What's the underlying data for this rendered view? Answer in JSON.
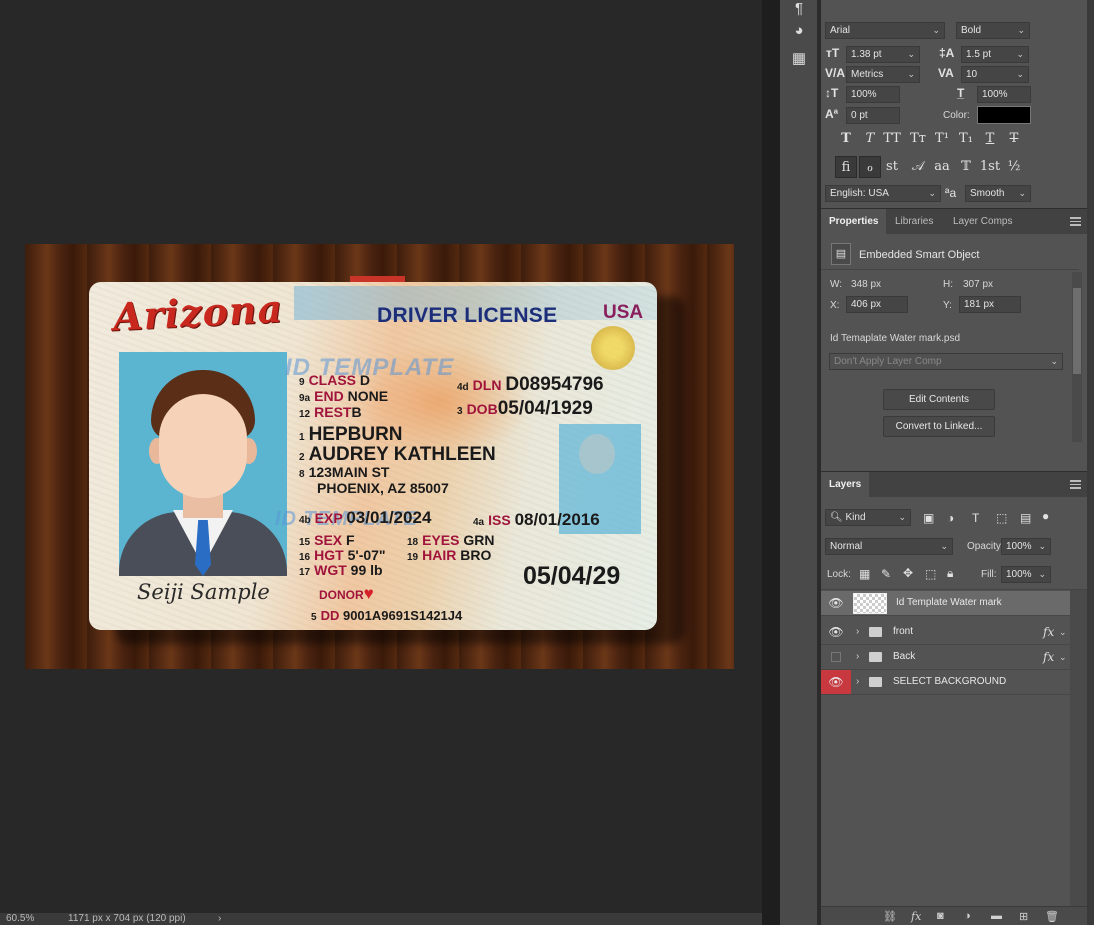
{
  "status_bar": {
    "zoom": "60.5%",
    "doc_info": "1171 px x 704 px (120 ppi)",
    "arrow": "›"
  },
  "document": {
    "card": {
      "state_name": "Arizona",
      "title": "DRIVER LICENSE",
      "country": "USA",
      "watermark_1": "ID TEMPLATE",
      "watermark_2": "ID TEMPLATE",
      "signature": "Seiji Sample",
      "class_num": "9",
      "class_label": "CLASS",
      "class_value": "D",
      "end_num": "9a",
      "end_label": "END",
      "end_value": "NONE",
      "rest_num": "12",
      "rest_label": "REST",
      "rest_value": "B",
      "dln_num": "4d",
      "dln_label": "DLN",
      "dln_value": "D08954796",
      "dob_num": "3",
      "dob_label": "DOB",
      "dob_value": "05/04/1929",
      "surname_num": "1",
      "surname": "HEPBURN",
      "given_num": "2",
      "given": "AUDREY KATHLEEN",
      "addr_num": "8",
      "address_1": "123MAIN ST",
      "address_2": "PHOENIX, AZ 85007",
      "exp_num": "4b",
      "exp_label": "EXP",
      "exp_value": "03/01/2024",
      "iss_num": "4a",
      "iss_label": "ISS",
      "iss_value": "08/01/2016",
      "sex_num": "15",
      "sex_label": "SEX",
      "sex_value": "F",
      "eyes_num": "18",
      "eyes_label": "EYES",
      "eyes_value": "GRN",
      "hgt_num": "16",
      "hgt_label": "HGT",
      "hgt_value": "5'-07\"",
      "hair_num": "19",
      "hair_label": "HAIR",
      "hair_value": "BRO",
      "wgt_num": "17",
      "wgt_label": "WGT",
      "wgt_value": "99 lb",
      "donor": "DONOR",
      "heart": "♥",
      "dd_num": "5",
      "dd_label": "DD",
      "dd_value": "9001A9691S1421J4",
      "red_date": "05/04/29"
    }
  },
  "character_panel": {
    "font_family": "Arial",
    "font_style": "Bold",
    "font_size": "1.38 pt",
    "leading": "1.5 pt",
    "kerning": "Metrics",
    "tracking": "10",
    "vertical_scale": "100%",
    "horizontal_scale": "100%",
    "baseline_shift": "0 pt",
    "color_label": "Color:",
    "color": "#000000",
    "type_buttons": [
      "T",
      "T",
      "TT",
      "Tт",
      "T¹",
      "T₁",
      "T",
      "T"
    ],
    "opentype_buttons": [
      "fi",
      "ℴ",
      "st",
      "𝒜",
      "aa",
      "𝕋",
      "1st",
      "½"
    ],
    "language": "English: USA",
    "aa_icon": "ªa",
    "antialias": "Smooth"
  },
  "properties_panel": {
    "tabs": [
      "Properties",
      "Libraries",
      "Layer Comps"
    ],
    "object_type": "Embedded Smart Object",
    "w_label": "W:",
    "w_value": "348 px",
    "h_label": "H:",
    "h_value": "307 px",
    "x_label": "X:",
    "x_value": "406 px",
    "y_label": "Y:",
    "y_value": "181 px",
    "filename": "Id Temaplate Water mark.psd",
    "layer_comp": "Don't Apply Layer Comp",
    "edit_button": "Edit Contents",
    "convert_button": "Convert to Linked..."
  },
  "layers_panel": {
    "tab": "Layers",
    "kind_filter": "Kind",
    "blend_mode": "Normal",
    "opacity_label": "Opacity:",
    "opacity": "100%",
    "lock_label": "Lock:",
    "fill_label": "Fill:",
    "fill": "100%",
    "layers": [
      {
        "name": "Id Template Water mark",
        "visible": true,
        "selected": true,
        "type": "smart-object"
      },
      {
        "name": "front",
        "visible": true,
        "selected": false,
        "type": "group",
        "fx": "fx"
      },
      {
        "name": "Back",
        "visible": false,
        "selected": false,
        "type": "group",
        "fx": "fx"
      },
      {
        "name": "SELECT BACKGROUND",
        "visible": true,
        "selected": false,
        "type": "group",
        "highlight": "#c8383f"
      }
    ]
  }
}
